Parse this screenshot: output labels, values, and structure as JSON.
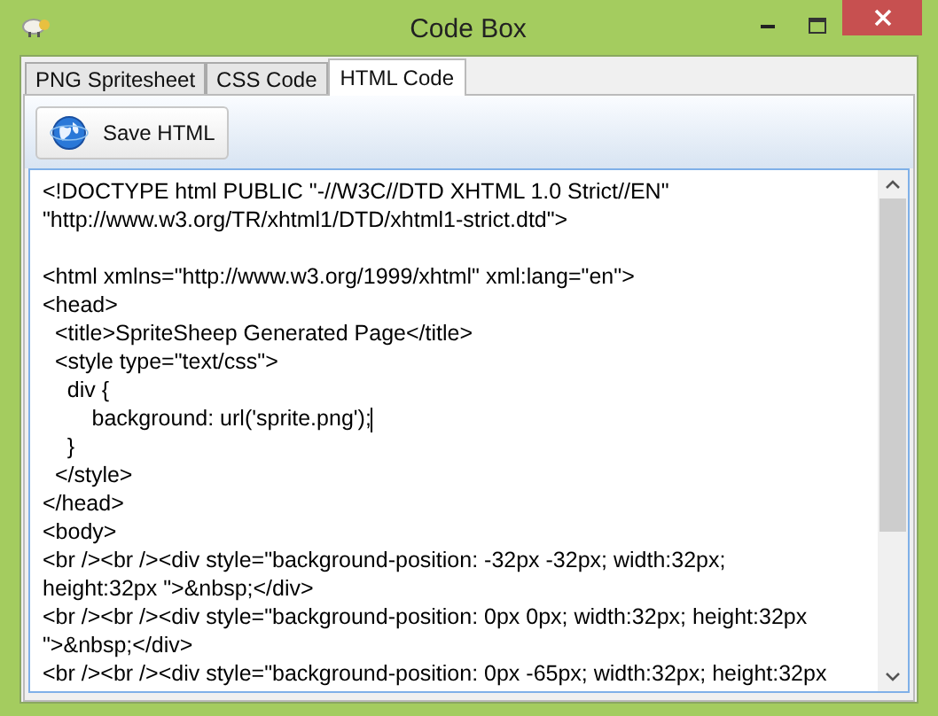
{
  "window": {
    "title": "Code Box"
  },
  "tabs": [
    {
      "label": "PNG Spritesheet",
      "selected": false
    },
    {
      "label": "CSS Code",
      "selected": false
    },
    {
      "label": "HTML Code",
      "selected": true
    }
  ],
  "toolbar": {
    "save_button": "Save HTML"
  },
  "editor": {
    "lines": [
      {
        "kind": "text",
        "text": "<!DOCTYPE html PUBLIC \"-//W3C//DTD XHTML 1.0 Strict//EN\""
      },
      {
        "kind": "text",
        "text": "\"http://www.w3.org/TR/xhtml1/DTD/xhtml1-strict.dtd\">"
      },
      {
        "kind": "blank"
      },
      {
        "kind": "text",
        "text": "<html xmlns=\"http://www.w3.org/1999/xhtml\" xml:lang=\"en\">"
      },
      {
        "kind": "text",
        "text": "<head>"
      },
      {
        "kind": "text",
        "text": "  <title>SpriteSheep Generated Page</title>"
      },
      {
        "kind": "text",
        "text": "  <style type=\"text/css\">"
      },
      {
        "kind": "text",
        "text": "    div {"
      },
      {
        "kind": "text",
        "text": "        background: url('sprite.png');",
        "cursor": true
      },
      {
        "kind": "text",
        "text": "    }"
      },
      {
        "kind": "text",
        "text": "  </style>"
      },
      {
        "kind": "text",
        "text": "</head>"
      },
      {
        "kind": "text",
        "text": "<body>"
      },
      {
        "kind": "text",
        "text": "<br /><br /><div style=\"background-position: -32px -32px; width:32px;"
      },
      {
        "kind": "text",
        "text": "height:32px \">&nbsp;</div>"
      },
      {
        "kind": "text",
        "text": "<br /><br /><div style=\"background-position: 0px 0px; width:32px; height:32px"
      },
      {
        "kind": "text",
        "text": "\">&nbsp;</div>"
      },
      {
        "kind": "text",
        "text": "<br /><br /><div style=\"background-position: 0px -65px; width:32px; height:32px"
      }
    ]
  }
}
